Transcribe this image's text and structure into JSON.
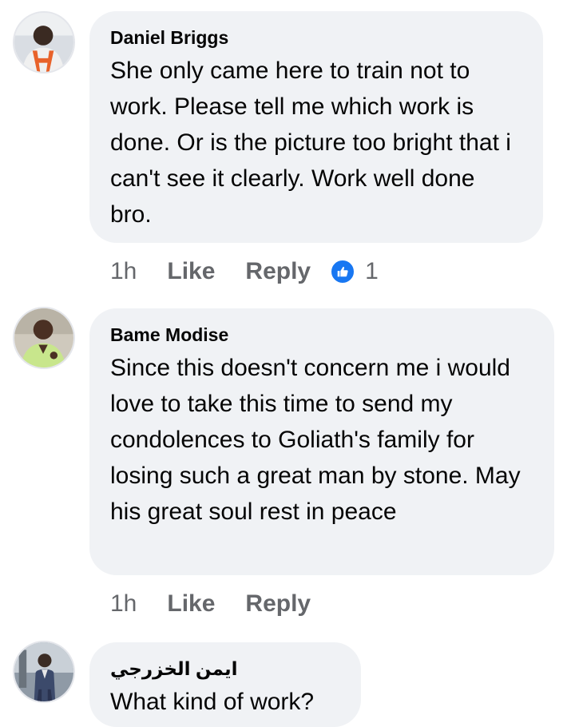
{
  "comments": [
    {
      "author": "Daniel Briggs",
      "text": "She only came here to train not to work. Please tell me which work is done. Or is the picture too bright that i can't see it clearly. Work well done bro.",
      "time": "1h",
      "like_label": "Like",
      "reply_label": "Reply",
      "reaction_icon": "thumbs-up-icon",
      "reaction_count": "1"
    },
    {
      "author": "Bame Modise",
      "text": "Since this doesn't concern me i would love to take this time to send my condolences to Goliath's family for losing such a great man by stone. May his great soul rest in peace",
      "time": "1h",
      "like_label": "Like",
      "reply_label": "Reply"
    },
    {
      "author": "ايمن الخزرجي",
      "text": "What kind of work?"
    }
  ],
  "colors": {
    "bubble": "#f0f2f5",
    "text": "#050505",
    "meta": "#65676b",
    "like_blue": "#1877f2"
  }
}
